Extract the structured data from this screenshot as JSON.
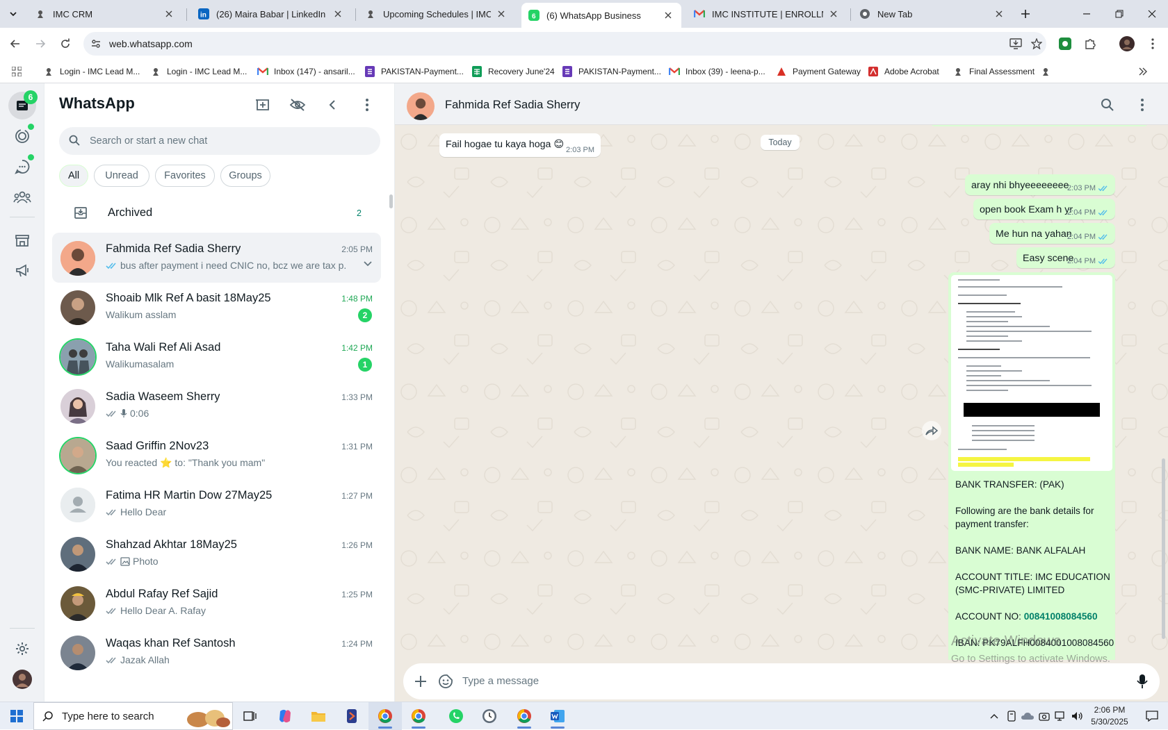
{
  "browser": {
    "tabs": [
      {
        "title": "IMC CRM",
        "favicon": "imc-crm-icon"
      },
      {
        "title": "(26) Maira Babar | LinkedIn",
        "favicon": "linkedin-icon"
      },
      {
        "title": "Upcoming Schedules | IMC Certi",
        "favicon": "imc-icon"
      },
      {
        "title": "(6) WhatsApp Business",
        "favicon": "whatsapp-icon"
      },
      {
        "title": "IMC INSTITUTE | ENROLLMENT",
        "favicon": "gmail-icon"
      },
      {
        "title": "New Tab",
        "favicon": "chrome-icon"
      }
    ],
    "url": "web.whatsapp.com",
    "bookmarks": [
      "Login - IMC Lead M...",
      "Login - IMC Lead M...",
      "Inbox (147) - ansaril...",
      "PAKISTAN-Payment...",
      "Recovery June'24",
      "PAKISTAN-Payment...",
      "Inbox (39) - leena-p...",
      "Payment Gateway",
      "Adobe Acrobat",
      "Final Assessment"
    ]
  },
  "rail": {
    "chats_badge": "6"
  },
  "sidebar": {
    "title": "WhatsApp",
    "search_placeholder": "Search or start a new chat",
    "filters": [
      "All",
      "Unread",
      "Favorites",
      "Groups"
    ],
    "archived_label": "Archived",
    "archived_count": "2"
  },
  "chats": [
    {
      "name": "Fahmida Ref Sadia Sherry",
      "time": "2:05 PM",
      "preview": "bus after payment i need CNIC no, bcz we are tax p...",
      "unread": "",
      "ticks": "blue"
    },
    {
      "name": "Shoaib Mlk Ref A basit 18May25",
      "time": "1:48 PM",
      "preview": "Walikum asslam",
      "unread": "2",
      "ticks": ""
    },
    {
      "name": "Taha Wali Ref Ali Asad",
      "time": "1:42 PM",
      "preview": "Walikumasalam",
      "unread": "1",
      "ticks": ""
    },
    {
      "name": "Sadia Waseem Sherry",
      "time": "1:33 PM",
      "preview": "0:06",
      "unread": "",
      "ticks": "grey"
    },
    {
      "name": "Saad Griffin 2Nov23",
      "time": "1:31 PM",
      "preview": "You reacted ⭐ to: \"Thank you mam\"",
      "unread": "",
      "ticks": ""
    },
    {
      "name": "Fatima HR Martin Dow 27May25",
      "time": "1:27 PM",
      "preview": "Hello Dear",
      "unread": "",
      "ticks": "grey"
    },
    {
      "name": "Shahzad Akhtar 18May25",
      "time": "1:26 PM",
      "preview": "Photo",
      "unread": "",
      "ticks": "grey"
    },
    {
      "name": "Abdul Rafay Ref Sajid",
      "time": "1:25 PM",
      "preview": "Hello Dear A. Rafay",
      "unread": "",
      "ticks": "grey"
    },
    {
      "name": "Waqas khan Ref Santosh",
      "time": "1:24 PM",
      "preview": "Jazak Allah",
      "unread": "",
      "ticks": "grey"
    }
  ],
  "conversation": {
    "contact_name": "Fahmida Ref Sadia Sherry",
    "date_divider": "Today",
    "messages": [
      {
        "dir": "in",
        "text": "Fail hogae tu kaya hoga 😊",
        "time": "2:03 PM"
      },
      {
        "dir": "out",
        "text": "aray nhi bhyeeeeeeee",
        "time": "2:03 PM"
      },
      {
        "dir": "out",
        "text": "open book Exam h yr",
        "time": "2:04 PM"
      },
      {
        "dir": "out",
        "text": "Me hun na yahan",
        "time": "2:04 PM"
      },
      {
        "dir": "out",
        "text": "Easy scene",
        "time": "2:04 PM"
      }
    ],
    "bank": {
      "heading": "BANK TRANSFER: (PAK)",
      "intro_1": "Following are the bank details for",
      "intro_2": "payment transfer:",
      "bank_name": "BANK NAME: BANK ALFALAH",
      "title_1": "ACCOUNT TITLE: IMC EDUCATION",
      "title_2": "(SMC-PRIVATE) LIMITED",
      "account_label": "ACCOUNT NO: ",
      "account_no": "00841008084560",
      "iban": "IBAN: PK79ALFH0084001008084560"
    },
    "composer_placeholder": "Type a message",
    "watermark_title": "Activate Windows",
    "watermark_sub": "Go to Settings to activate Windows."
  },
  "taskbar": {
    "search_placeholder": "Type here to search",
    "time": "2:06 PM",
    "date": "5/30/2025"
  },
  "colors": {
    "wa_green": "#25d366",
    "wa_teal": "#008069",
    "outgoing_bubble": "#d9fdd3",
    "chat_bg": "#efeae2",
    "read_tick": "#53bdeb"
  }
}
